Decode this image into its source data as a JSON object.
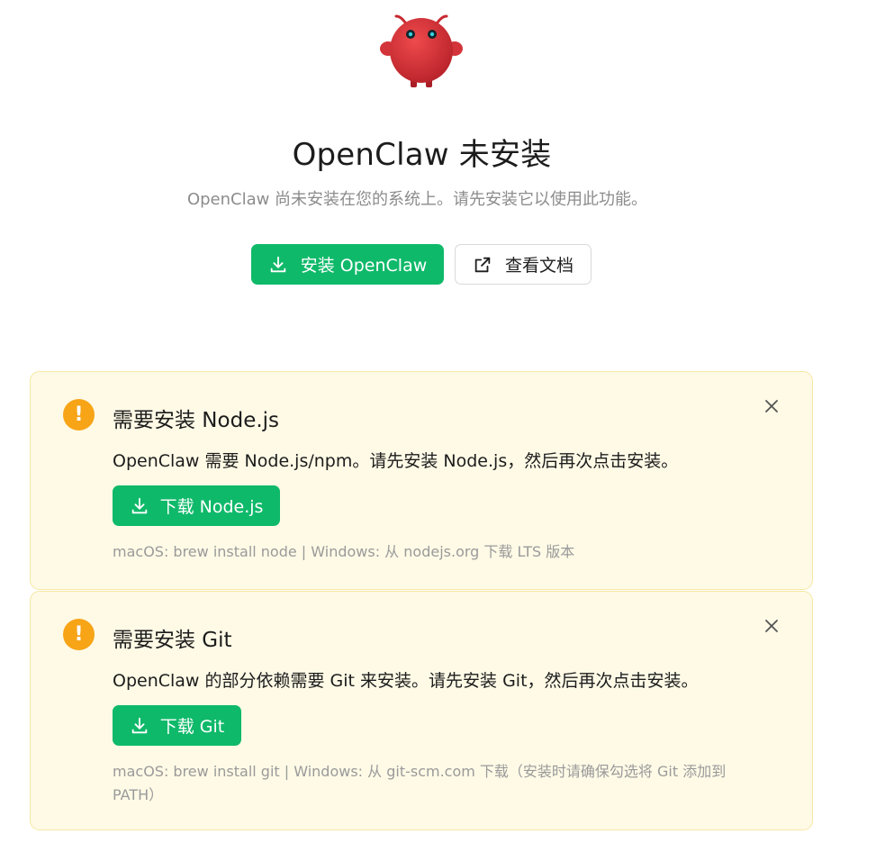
{
  "hero": {
    "title": "OpenClaw 未安装",
    "subtitle": "OpenClaw 尚未安装在您的系统上。请先安装它以使用此功能。",
    "install_label": "安装 OpenClaw",
    "docs_label": "查看文档"
  },
  "alerts": [
    {
      "title": "需要安装 Node.js",
      "description": "OpenClaw 需要 Node.js/npm。请先安装 Node.js，然后再次点击安装。",
      "button_label": "下载 Node.js",
      "hint": "macOS: brew install node | Windows: 从 nodejs.org 下载 LTS 版本"
    },
    {
      "title": "需要安装 Git",
      "description": "OpenClaw 的部分依赖需要 Git 来安装。请先安装 Git，然后再次点击安装。",
      "button_label": "下载 Git",
      "hint": "macOS: brew install git | Windows: 从 git-scm.com 下载（安装时请确保勾选将 Git 添加到 PATH）"
    }
  ],
  "colors": {
    "primary": "#0fb96a",
    "warning": "#f7a416",
    "alert_bg": "#fefae6",
    "alert_border": "#f7e7a3",
    "mascot": "#d93236"
  },
  "icons": {
    "warning": "!"
  }
}
